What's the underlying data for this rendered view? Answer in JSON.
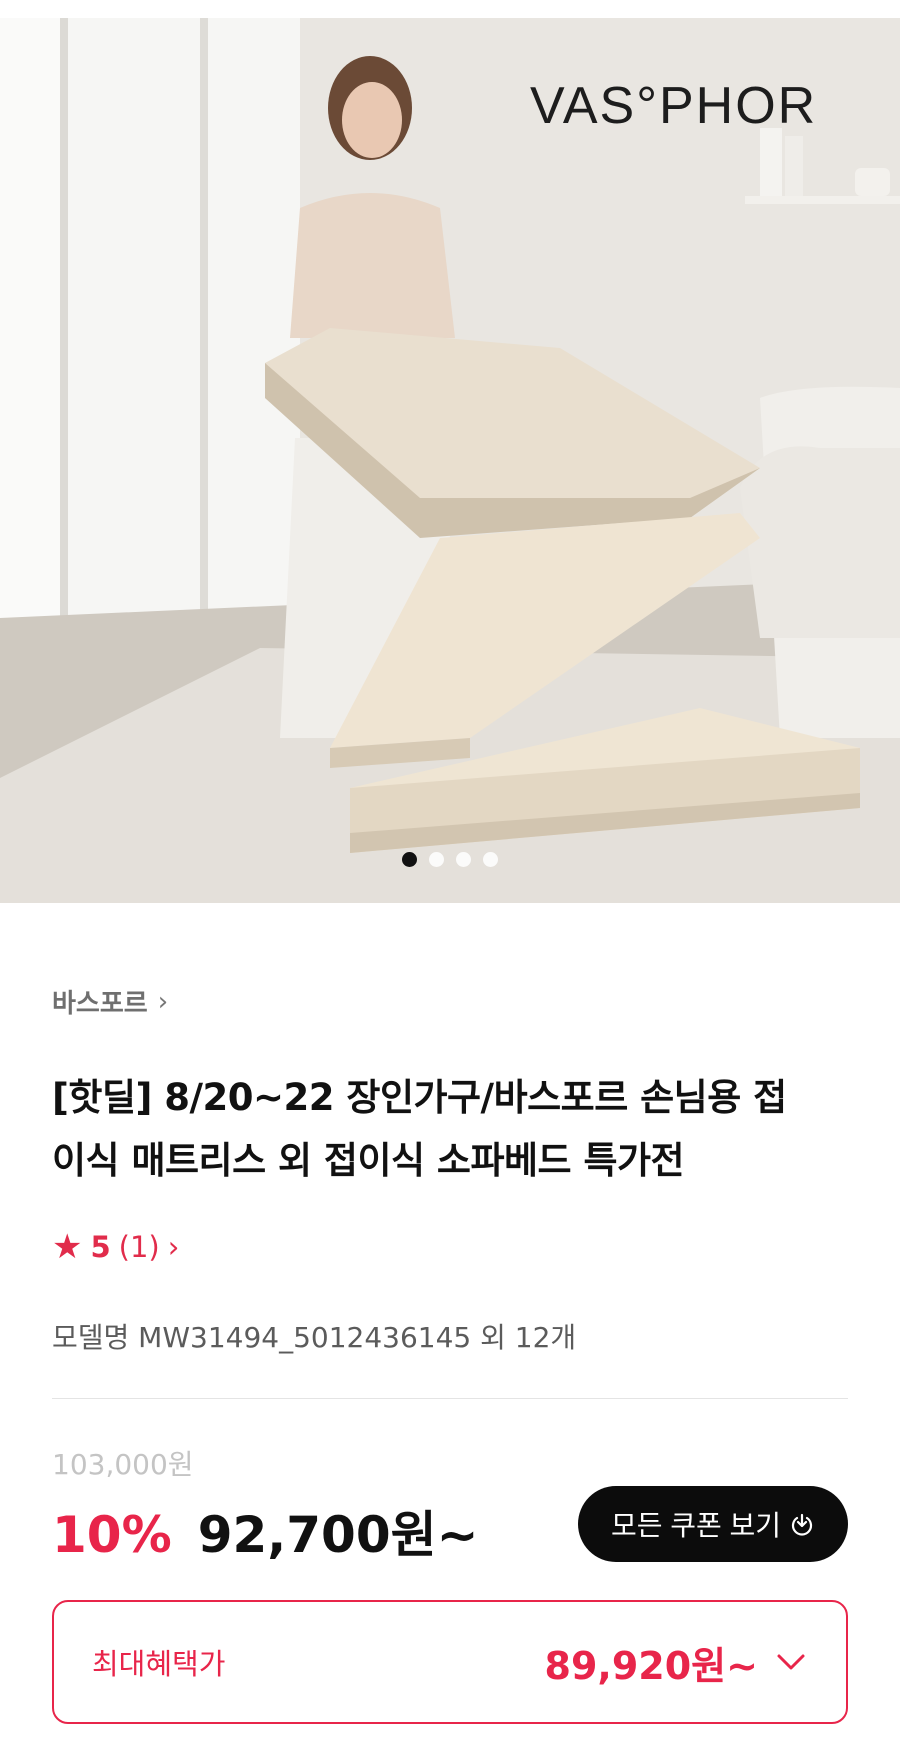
{
  "hero": {
    "brand_logo": "VAS°PHOR",
    "carousel": {
      "total": 4,
      "active_index": 0
    }
  },
  "seller": {
    "name": "바스포르"
  },
  "product": {
    "title_line1": "[핫딜] 8/20~22 장인가구/바스포르 손님용 접",
    "title_line2": "이식 매트리스 외 접이식 소파베드 특가전",
    "rating": {
      "score": "5",
      "count": "(1)"
    },
    "model": "모델명 MW31494_5012436145 외 12개"
  },
  "price": {
    "original": "103,000원",
    "discount": "10%",
    "sale": "92,700원~",
    "coupon_button": "모든 쿠폰 보기"
  },
  "benefit": {
    "label": "최대혜택가",
    "price": "89,920원~"
  },
  "colors": {
    "accent": "#e8254a",
    "button_bg": "#0c0c0c"
  }
}
